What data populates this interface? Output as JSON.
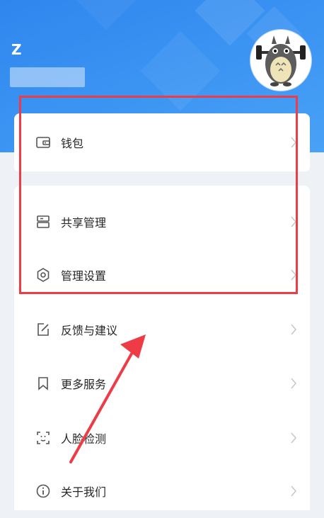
{
  "profile": {
    "username": "Z"
  },
  "menu": {
    "wallet": "钱包",
    "share_management": "共享管理",
    "management_settings": "管理设置",
    "feedback": "反馈与建议",
    "more_services": "更多服务",
    "face_detection": "人脸检测",
    "about_us": "关于我们"
  },
  "colors": {
    "header_blue": "#3a92f2",
    "highlight_red": "#ee3b46",
    "arrow_red": "#ee3b46"
  },
  "icons": [
    "wallet-icon",
    "share-icon",
    "settings-icon",
    "feedback-icon",
    "bookmark-icon",
    "face-scan-icon",
    "info-icon",
    "chevron-right-icon"
  ]
}
